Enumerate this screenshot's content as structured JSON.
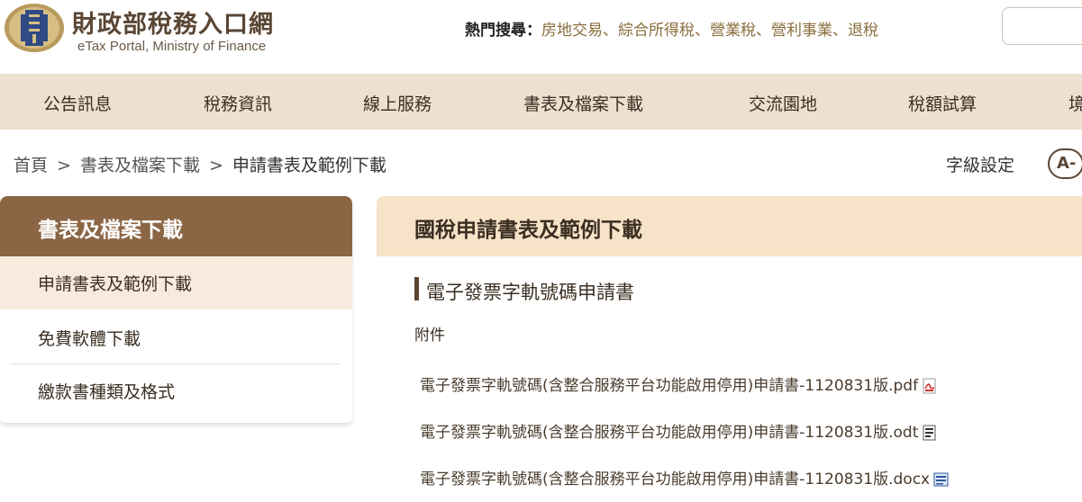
{
  "header": {
    "logo_icon": "mof-emblem-icon",
    "site_title": "財政部稅務入口網",
    "site_subtitle": "eTax Portal, Ministry of Finance",
    "hot_search_label": "熱門搜尋：",
    "hot_search_links": [
      "房地交易",
      "綜合所得稅",
      "營業稅",
      "營利事業",
      "退稅"
    ],
    "separator": "、"
  },
  "nav": {
    "items": [
      "公告訊息",
      "稅務資訊",
      "線上服務",
      "書表及檔案下載",
      "交流園地",
      "稅額試算",
      "境"
    ]
  },
  "breadcrumb": {
    "home": "首頁",
    "separator": ">",
    "level1": "書表及檔案下載",
    "current": "申請書表及範例下載"
  },
  "font_settings": {
    "label": "字級設定",
    "smaller": "A-"
  },
  "sidebar": {
    "title": "書表及檔案下載",
    "items": [
      {
        "label": "申請書表及範例下載",
        "active": true
      },
      {
        "label": "免費軟體下載",
        "active": false
      },
      {
        "label": "繳款書種類及格式",
        "active": false
      }
    ]
  },
  "content": {
    "title": "國稅申請書表及範例下載",
    "section_title": "電子發票字軌號碼申請書",
    "attachments_label": "附件",
    "files": [
      {
        "name": "電子發票字軌號碼(含整合服務平台功能啟用停用)申請書-1120831版.pdf",
        "icon": "pdf-icon"
      },
      {
        "name": "電子發票字軌號碼(含整合服務平台功能啟用停用)申請書-1120831版.odt",
        "icon": "odt-icon"
      },
      {
        "name": "電子發票字軌號碼(含整合服務平台功能啟用停用)申請書-1120831版.docx",
        "icon": "docx-icon"
      }
    ]
  },
  "colors": {
    "nav_bg": "#ece0d0",
    "sidebar_head_bg": "#8b6645",
    "sidebar_active_bg": "#f7ebdd",
    "content_head_bg": "#f7e3c8",
    "accent_brown": "#5a4634"
  }
}
